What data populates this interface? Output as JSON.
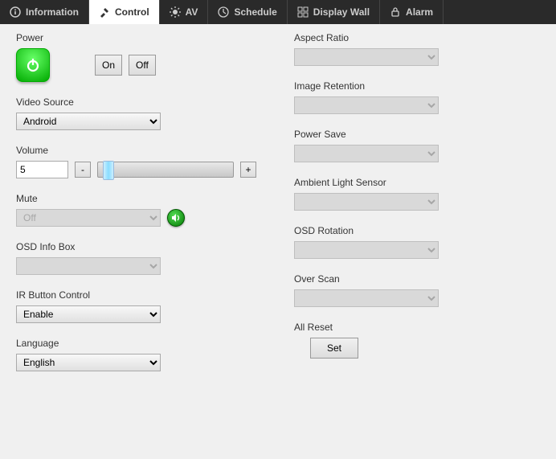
{
  "tabs": [
    {
      "label": "Information"
    },
    {
      "label": "Control"
    },
    {
      "label": "AV"
    },
    {
      "label": "Schedule"
    },
    {
      "label": "Display Wall"
    },
    {
      "label": "Alarm"
    }
  ],
  "left": {
    "power": {
      "label": "Power",
      "on": "On",
      "off": "Off"
    },
    "video_source": {
      "label": "Video Source",
      "value": "Android"
    },
    "volume": {
      "label": "Volume",
      "value": "5",
      "minus": "-",
      "plus": "+"
    },
    "mute": {
      "label": "Mute",
      "value": "Off"
    },
    "osd_info": {
      "label": "OSD Info Box"
    },
    "ir_button": {
      "label": "IR Button Control",
      "value": "Enable"
    },
    "language": {
      "label": "Language",
      "value": "English"
    }
  },
  "right": {
    "aspect": {
      "label": "Aspect Ratio"
    },
    "image_retention": {
      "label": "Image Retention"
    },
    "power_save": {
      "label": "Power Save"
    },
    "ambient": {
      "label": "Ambient Light Sensor"
    },
    "osd_rotation": {
      "label": "OSD Rotation"
    },
    "over_scan": {
      "label": "Over Scan"
    },
    "all_reset": {
      "label": "All Reset",
      "button": "Set"
    }
  }
}
